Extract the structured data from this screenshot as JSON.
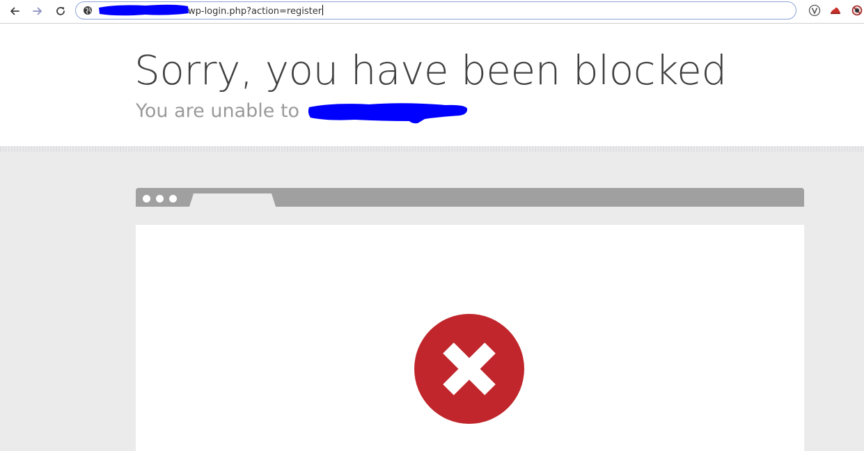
{
  "browser": {
    "url_suffix": "wp-login.php?action=register"
  },
  "page": {
    "headline": "Sorry, you have been blocked",
    "subhead": "You are unable to"
  },
  "colors": {
    "error_red": "#c0262b",
    "redaction_blue": "#0000ff",
    "bar_gray": "#a0a0a0",
    "section_gray": "#ebebeb"
  },
  "icons": {
    "back": "arrow-left-icon",
    "forward": "arrow-right-icon",
    "reload": "reload-icon",
    "site_info": "globe-icon",
    "extension_1": "vpn-extension-icon",
    "extension_2": "red-hat-extension-icon",
    "extension_3": "block-extension-icon",
    "error": "close-circle-icon"
  }
}
